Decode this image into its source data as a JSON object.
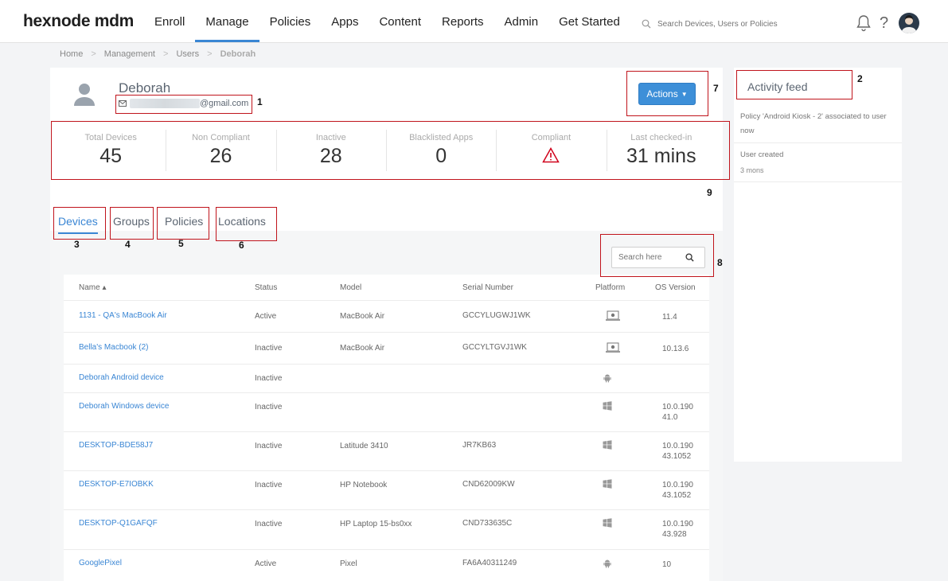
{
  "brand": "hexnode mdm",
  "nav": [
    "Enroll",
    "Manage",
    "Policies",
    "Apps",
    "Content",
    "Reports",
    "Admin",
    "Get Started"
  ],
  "nav_active": 1,
  "top_search_placeholder": "Search Devices, Users or Policies",
  "help_symbol": "?",
  "breadcrumb": [
    "Home",
    "Management",
    "Users",
    "Deborah"
  ],
  "user": {
    "name": "Deborah",
    "email_suffix": "@gmail.com"
  },
  "actions_label": "Actions",
  "stats": [
    {
      "label": "Total Devices",
      "value": "45"
    },
    {
      "label": "Non Compliant",
      "value": "26"
    },
    {
      "label": "Inactive",
      "value": "28"
    },
    {
      "label": "Blacklisted Apps",
      "value": "0"
    },
    {
      "label": "Compliant",
      "value": ""
    },
    {
      "label": "Last checked-in",
      "value": "31 mins"
    }
  ],
  "tabs": [
    "Devices",
    "Groups",
    "Policies",
    "Locations"
  ],
  "search_placeholder": "Search here",
  "table": {
    "headers": [
      "Name ▴",
      "Status",
      "Model",
      "Serial Number",
      "Platform",
      "OS Version"
    ],
    "rows": [
      {
        "name": "1131 - QA's MacBook Air",
        "status": "Active",
        "model": "MacBook Air",
        "serial": "GCCYLUGWJ1WK",
        "platform": "mac",
        "os": "11.4"
      },
      {
        "name": "Bella's Macbook (2)",
        "status": "Inactive",
        "model": "MacBook Air",
        "serial": "GCCYLTGVJ1WK",
        "platform": "mac",
        "os": "10.13.6"
      },
      {
        "name": "Deborah Android device",
        "status": "Inactive",
        "model": "",
        "serial": "",
        "platform": "android",
        "os": ""
      },
      {
        "name": "Deborah Windows device",
        "status": "Inactive",
        "model": "",
        "serial": "",
        "platform": "windows",
        "os": "10.0.190\n41.0"
      },
      {
        "name": "DESKTOP-BDE58J7",
        "status": "Inactive",
        "model": "Latitude 3410",
        "serial": "JR7KB63",
        "platform": "windows",
        "os": "10.0.190\n43.1052"
      },
      {
        "name": "DESKTOP-E7IOBKK",
        "status": "Inactive",
        "model": "HP Notebook",
        "serial": "CND62009KW",
        "platform": "windows",
        "os": "10.0.190\n43.1052"
      },
      {
        "name": "DESKTOP-Q1GAFQF",
        "status": "Inactive",
        "model": "HP Laptop 15-bs0xx",
        "serial": "CND733635C",
        "platform": "windows",
        "os": "10.0.190\n43.928"
      },
      {
        "name": "GooglePixel",
        "status": "Active",
        "model": "Pixel",
        "serial": "FA6A40311249",
        "platform": "android",
        "os": "10"
      }
    ]
  },
  "activity": {
    "title": "Activity feed",
    "items": [
      {
        "text": "Policy 'Android Kiosk - 2' associated to user now"
      },
      {
        "text": "User created",
        "time": "3 mons"
      }
    ]
  },
  "annotations": [
    "1",
    "2",
    "3",
    "4",
    "5",
    "6",
    "7",
    "8",
    "9"
  ],
  "colors": {
    "accent": "#3a86d4",
    "annotation": "#c0141c",
    "warning": "#d0021b"
  }
}
